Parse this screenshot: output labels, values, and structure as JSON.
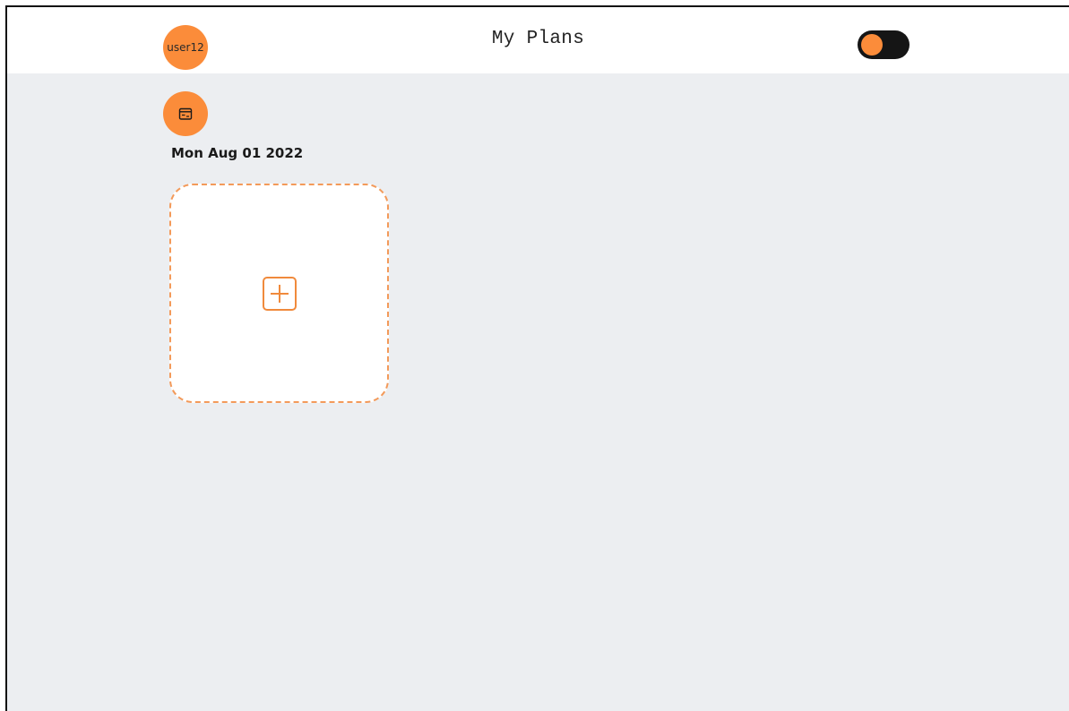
{
  "header": {
    "username": "user12",
    "title": "My Plans",
    "theme_toggle": "toggle-icon"
  },
  "main": {
    "calendar_button_icon": "calendar-icon",
    "date": "Mon Aug 01 2022",
    "add_plan_icon": "plus-square-icon"
  },
  "colors": {
    "accent": "#fb8c3a",
    "background": "#eceef1",
    "header_background": "#ffffff",
    "toggle_track": "#151515",
    "card_border": "#f39a5a"
  }
}
